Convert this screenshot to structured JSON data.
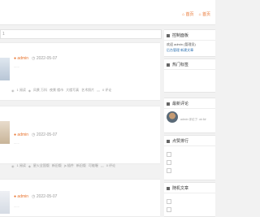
{
  "nav": {
    "home": "首页",
    "item2": "首页"
  },
  "search": {
    "placeholder": "1"
  },
  "posts": [
    {
      "author": "admin",
      "date": "2022-05-07",
      "excerpt": "......",
      "tags": [
        "1 阅读",
        "风景 万科",
        "夜景 楼市",
        "大楼写真",
        "艺术照片",
        "0 评论"
      ]
    },
    {
      "author": "admin",
      "date": "2022-05-07",
      "excerpt": "......",
      "tags": [
        "1 阅读",
        "星火全国版",
        "新旧版",
        "js 插件",
        "新旧版",
        "可能喔",
        "0 评论"
      ]
    },
    {
      "author": "admin",
      "date": "2022-05-07",
      "excerpt": "......"
    }
  ],
  "sidebar": {
    "control_panel": {
      "title": "控制面板",
      "line1": "欢迎 admin (管理员)",
      "line2": "后台管理  新建文章"
    },
    "hot_tags": {
      "title": "热门标签"
    },
    "latest_comments": {
      "title": "最新评论",
      "comment": "admin 评论了: ok 6#"
    },
    "likes": {
      "title": "点赞排行"
    },
    "random": {
      "title": "随机文章"
    }
  },
  "colors": {
    "accent": "#e8722c",
    "link": "#2a6fb0"
  }
}
